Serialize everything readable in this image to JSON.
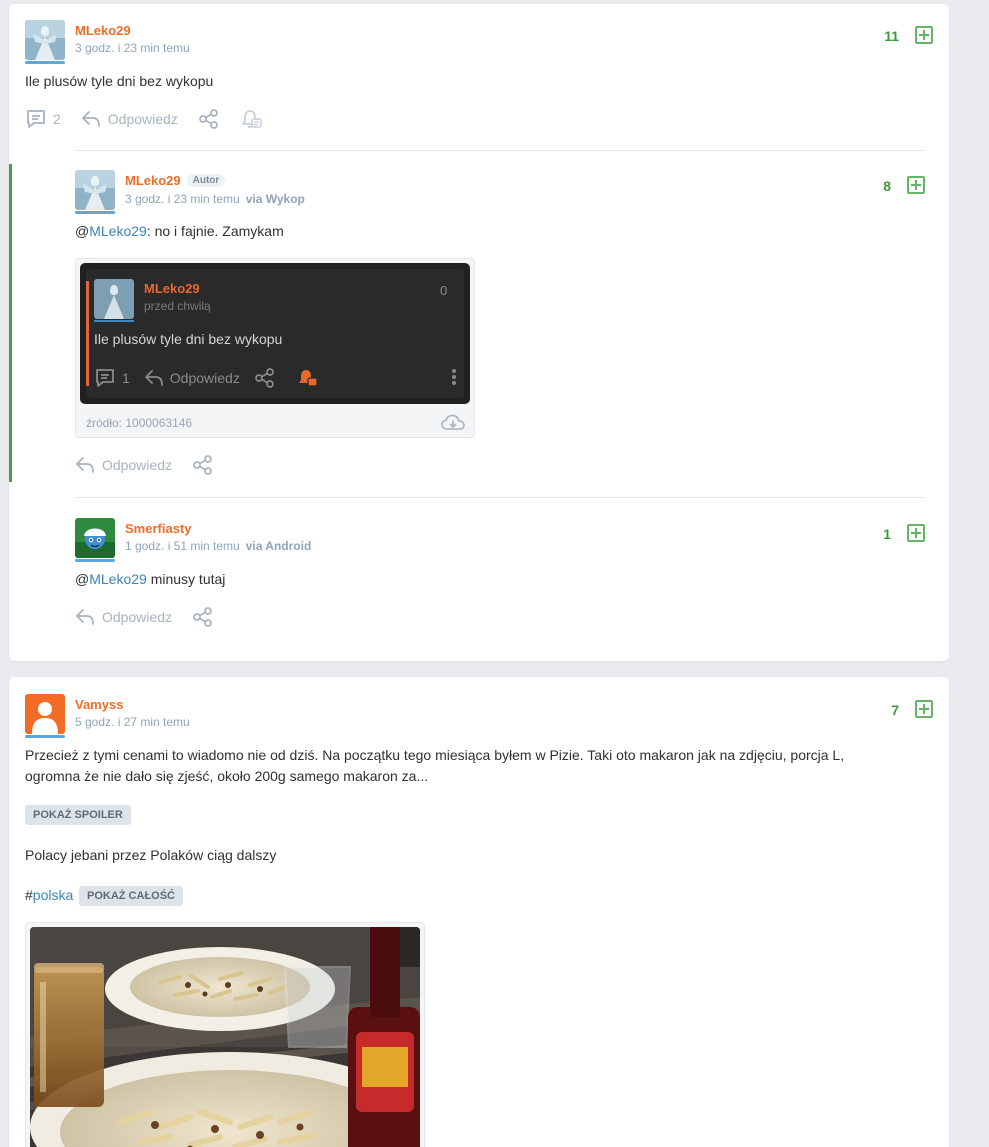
{
  "post1": {
    "username": "MLeko29",
    "time": "3 godz. i 23 min temu",
    "votes": "11",
    "body": "Ile plusów tyle dni bez wykopu",
    "comments_count": "2",
    "reply_label": "Odpowiedz"
  },
  "comment1": {
    "username": "MLeko29",
    "badge": "Autor",
    "time": "3 godz. i 23 min temu",
    "via": "via Wykop",
    "votes": "8",
    "at": "@",
    "mention": "MLeko29",
    "text": ": no i fajnie. Zamykam",
    "reply_label": "Odpowiedz",
    "embed": {
      "username": "MLeko29",
      "time": "przed chwilą",
      "votes": "0",
      "body": "Ile plusów tyle dni bez wykopu",
      "comments_count": "1",
      "reply_label": "Odpowiedz",
      "source": "źródło: 1000063146"
    }
  },
  "comment2": {
    "username": "Smerfiasty",
    "time": "1 godz. i 51 min temu",
    "via": "via Android",
    "votes": "1",
    "at": "@",
    "mention": "MLeko29",
    "text": " minusy tutaj",
    "reply_label": "Odpowiedz"
  },
  "post2": {
    "username": "Vamyss",
    "time": "5 godz. i 27 min temu",
    "votes": "7",
    "body_line1": "Przecież z tymi cenami to wiadomo nie od dziś. Na początku tego miesiąca byłem w Pizie. Taki oto makaron jak na zdjęciu, porcja L,",
    "body_line2": "ogromna że nie dało się zjeść, około 200g samego makaron za...",
    "spoiler_label": "POKAŻ SPOILER",
    "text2": "Polacy jebani przez Polaków ciąg dalszy",
    "hash": "#",
    "tag": "polska",
    "show_all_label": "POKAŻ CAŁOŚĆ"
  },
  "colors": {
    "username": "#f26c26",
    "vote": "#3c9a3c",
    "link": "#3a83b8",
    "thread_bar": "#3ea54a"
  }
}
